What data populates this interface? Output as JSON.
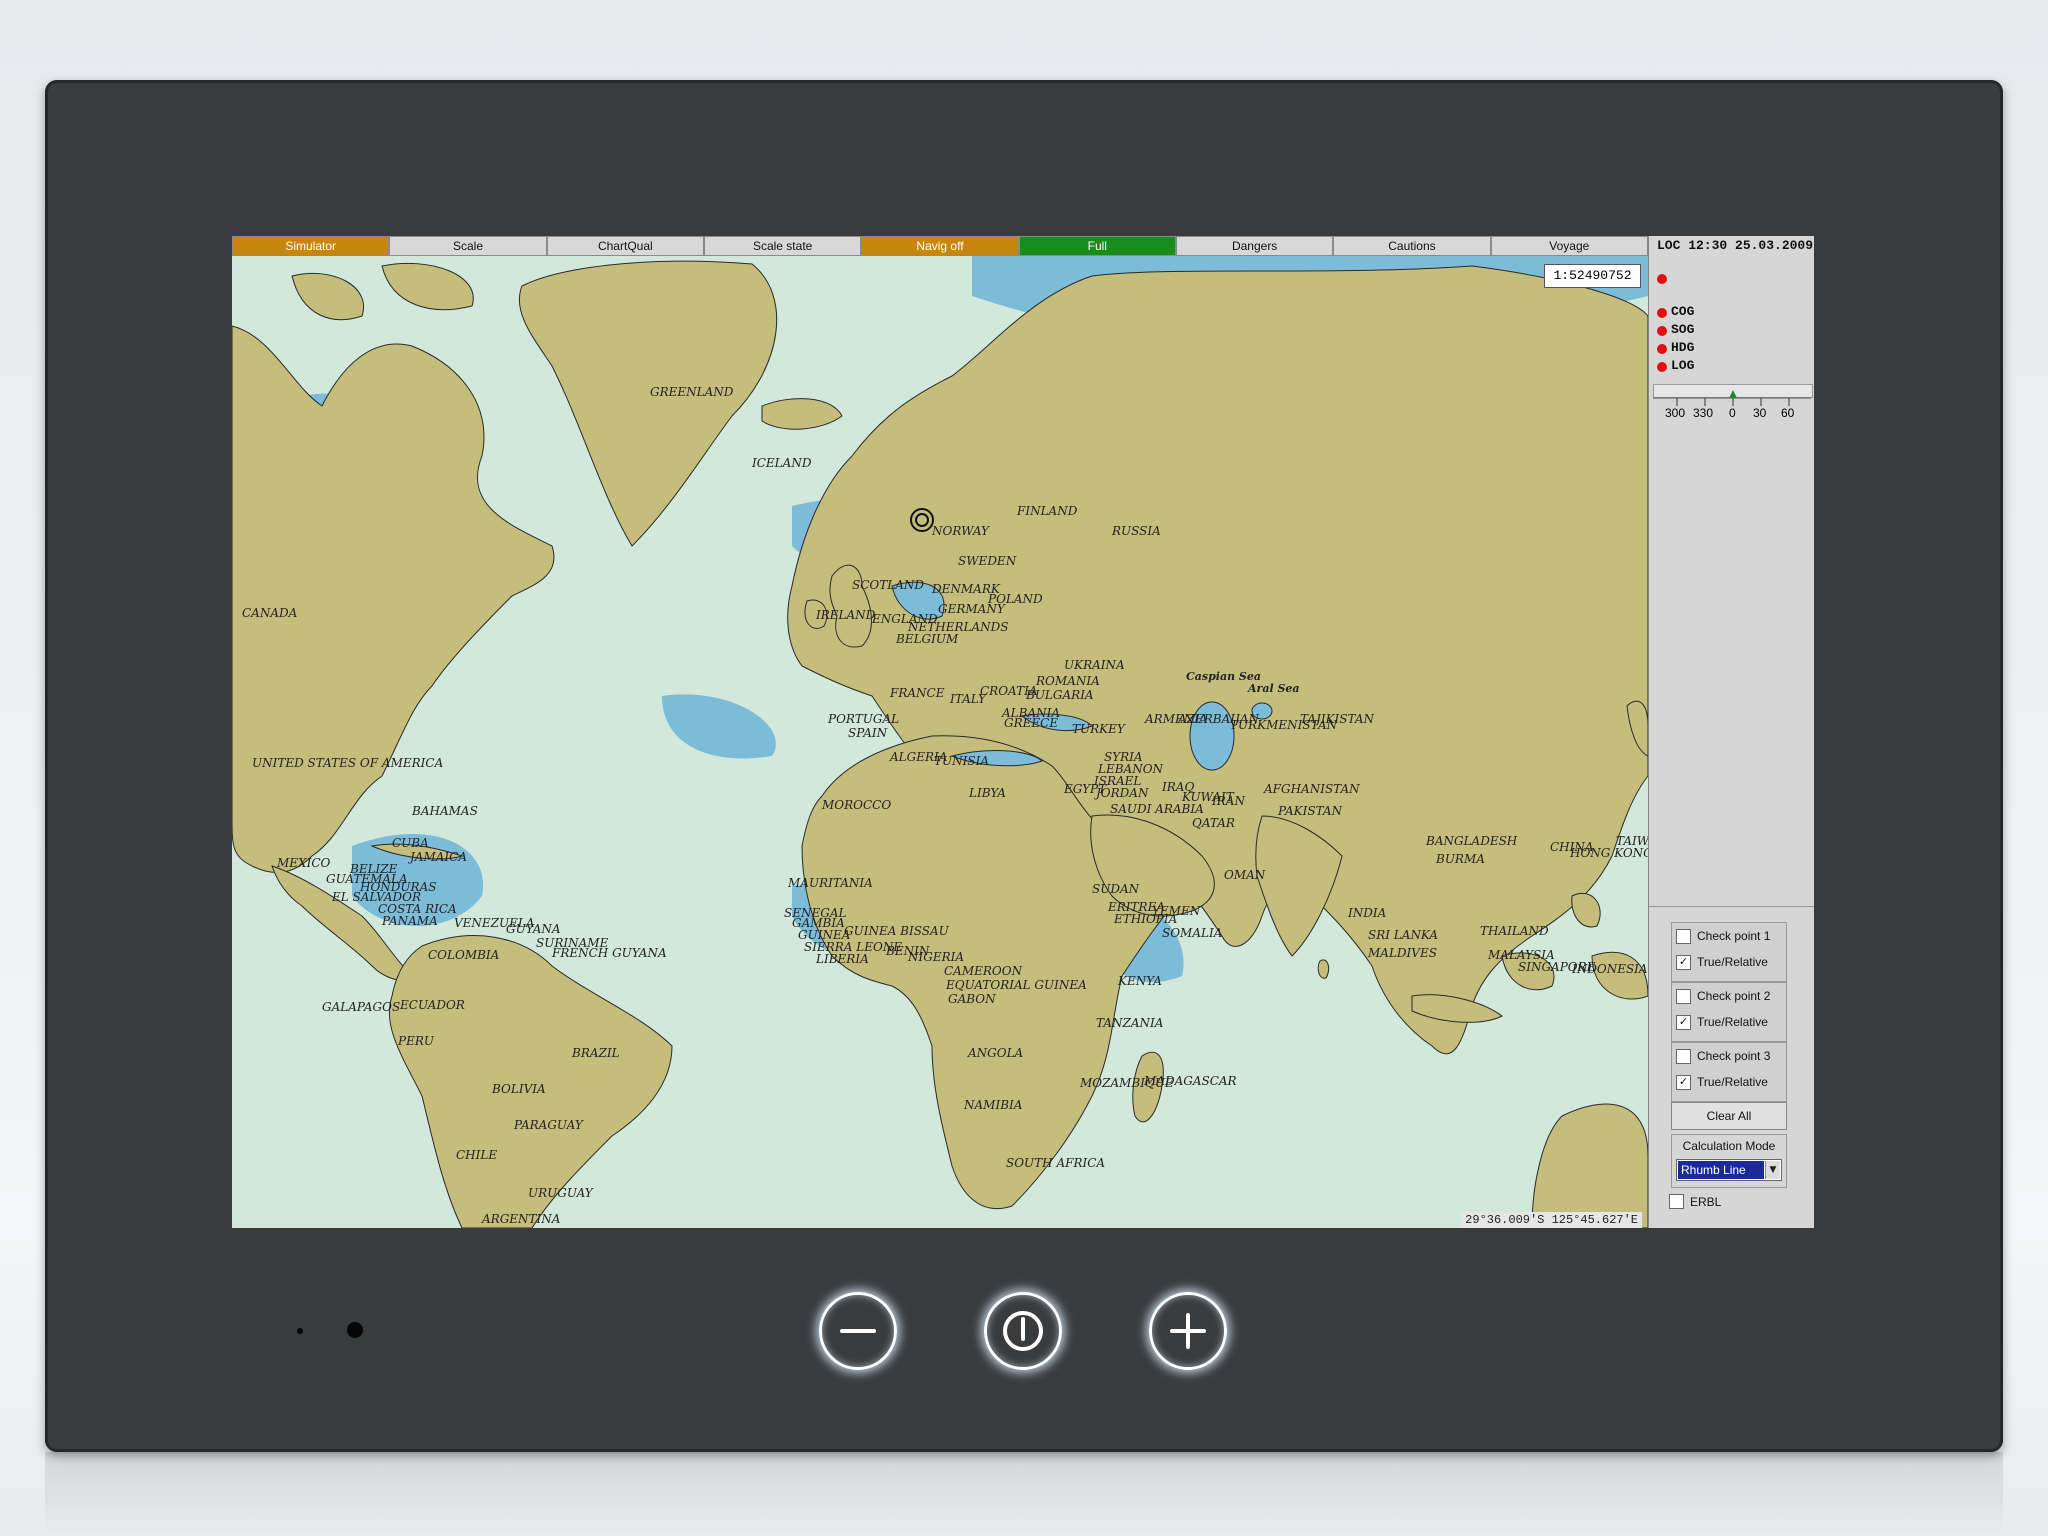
{
  "toolbar": {
    "tabs": [
      {
        "label": "Simulator",
        "style": "orange"
      },
      {
        "label": "Scale",
        "style": "plain"
      },
      {
        "label": "ChartQual",
        "style": "plain"
      },
      {
        "label": "Scale state",
        "style": "plain"
      },
      {
        "label": "Navig off",
        "style": "orange"
      },
      {
        "label": "Full",
        "style": "green"
      },
      {
        "label": "Dangers",
        "style": "plain"
      },
      {
        "label": "Cautions",
        "style": "plain"
      },
      {
        "label": "Voyage",
        "style": "plain"
      }
    ]
  },
  "map": {
    "scale": "1:52490752",
    "cursor_position": "29°36.009'S 125°45.627'E",
    "colors": {
      "land": "#c5bd7c",
      "sea": "#d2e8da",
      "shallow": "#7cbcd9"
    },
    "labels": [
      "GREENLAND",
      "ICELAND",
      "NORWAY",
      "FINLAND",
      "SWEDEN",
      "RUSSIA",
      "CANADA",
      "SCOTLAND",
      "DENMARK",
      "IRELAND",
      "ENGLAND",
      "GERMANY",
      "POLAND",
      "NETHERLANDS",
      "BELGIUM",
      "UKRAINA",
      "ROMANIA",
      "FRANCE",
      "CROATIA",
      "BULGARIA",
      "ITALY",
      "ALBANIA",
      "GREECE",
      "PORTUGAL",
      "SPAIN",
      "TURKEY",
      "ARMENIA",
      "AZERBAIJAN",
      "TURKMENISTAN",
      "TAJIKISTAN",
      "Caspian Sea",
      "Aral Sea",
      "UNITED STATES OF AMERICA",
      "ALGERIA",
      "TUNISIA",
      "SYRIA",
      "LEBANON",
      "ISRAEL",
      "JORDAN",
      "IRAQ",
      "IRAN",
      "KUWAIT",
      "AFGHANISTAN",
      "PAKISTAN",
      "LIBYA",
      "EGYPT",
      "SAUDI ARABIA",
      "QATAR",
      "BAHAMAS",
      "MOROCCO",
      "CUBA",
      "MEXICO",
      "JAMAICA",
      "BELIZE",
      "GUATEMALA",
      "HONDURAS",
      "EL SALVADOR",
      "COSTA RICA",
      "PANAMA",
      "VENEZUELA",
      "GUYANA",
      "SURINAME",
      "FRENCH GUYANA",
      "COLOMBIA",
      "MAURITANIA",
      "SENEGAL",
      "GAMBIA",
      "GUINEA BISSAU",
      "GUINEA",
      "SIERRA LEONE",
      "LIBERIA",
      "BENIN",
      "NIGERIA",
      "CAMEROON",
      "EQUATORIAL GUINEA",
      "GABON",
      "SUDAN",
      "ERITREA",
      "ETHIOPIA",
      "YEMEN",
      "SOMALIA",
      "OMAN",
      "KENYA",
      "TANZANIA",
      "ANGOLA",
      "NAMIBIA",
      "MOZAMBIQUE",
      "MADAGASCAR",
      "SOUTH AFRICA",
      "GALAPAGOS",
      "ECUADOR",
      "PERU",
      "BRAZIL",
      "BOLIVIA",
      "PARAGUAY",
      "CHILE",
      "URUGUAY",
      "ARGENTINA",
      "INDIA",
      "BANGLADESH",
      "BURMA",
      "CHINA",
      "TAIWAN",
      "HONG KONG",
      "THAILAND",
      "MALAYSIA",
      "SINGAPORE",
      "INDONESIA",
      "SRI LANKA",
      "MALDIVES"
    ]
  },
  "panel": {
    "loc": "LOC 12:30 25.03.2009",
    "indicators": [
      "COG",
      "SOG",
      "HDG",
      "LOG"
    ],
    "compass_ticks": [
      "300",
      "330",
      "0",
      "30",
      "60"
    ],
    "check_points": [
      {
        "label": "Check point 1",
        "relative_label": "True/Relative",
        "checked": false,
        "relative_checked": true
      },
      {
        "label": "Check point 2",
        "relative_label": "True/Relative",
        "checked": false,
        "relative_checked": true
      },
      {
        "label": "Check point 3",
        "relative_label": "True/Relative",
        "checked": false,
        "relative_checked": true
      }
    ],
    "clear_all": "Clear All",
    "calc_mode_label": "Calculation Mode",
    "calc_mode_value": "Rhumb Line",
    "erbl_label": "ERBL",
    "erbl_checked": false
  },
  "hardware": {
    "buttons": [
      {
        "name": "zoom-out",
        "icon": "minus-icon"
      },
      {
        "name": "power",
        "icon": "power-icon"
      },
      {
        "name": "zoom-in",
        "icon": "plus-icon"
      }
    ]
  }
}
